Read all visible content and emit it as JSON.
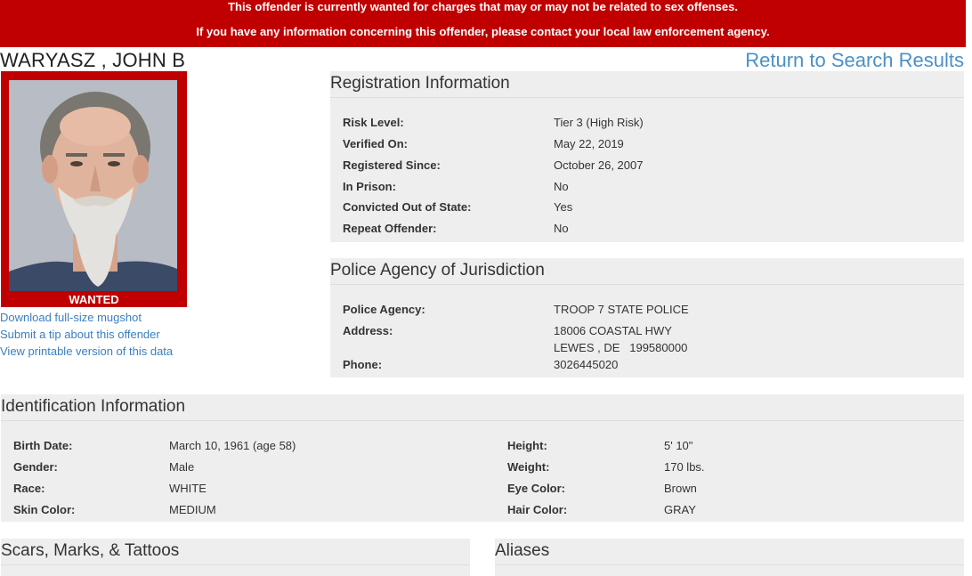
{
  "banner": {
    "line1": "This offender is currently wanted for charges that may or may not be related to sex offenses.",
    "line2": "If you have any information concerning this offender, please contact your local law enforcement agency."
  },
  "offender": {
    "name": "WARYASZ , JOHN B",
    "photo_label": "WANTED"
  },
  "links": {
    "return": "Return to Search Results",
    "download": "Download full-size mugshot",
    "tip": "Submit a tip about this offender",
    "printable": "View printable version of this data"
  },
  "registration": {
    "title": "Registration Information",
    "rows": [
      {
        "label": "Risk Level:",
        "value": "Tier 3 (High Risk)"
      },
      {
        "label": "Verified On:",
        "value": "May 22, 2019"
      },
      {
        "label": "Registered Since:",
        "value": "October 26, 2007"
      },
      {
        "label": "In Prison:",
        "value": "No"
      },
      {
        "label": "Convicted Out of State:",
        "value": "Yes"
      },
      {
        "label": "Repeat Offender:",
        "value": "No"
      }
    ]
  },
  "police": {
    "title": "Police Agency of Jurisdiction",
    "agency_label": "Police Agency:",
    "agency_value": "TROOP 7 STATE POLICE",
    "address_label": "Address:",
    "address_line1": "18006 COASTAL HWY",
    "address_line2": "LEWES , DE   199580000",
    "phone_label": "Phone:",
    "phone_value": "3026445020"
  },
  "identification": {
    "title": "Identification Information",
    "left": [
      {
        "label": "Birth Date:",
        "value": "March 10, 1961 (age 58)"
      },
      {
        "label": "Gender:",
        "value": "Male"
      },
      {
        "label": "Race:",
        "value": "WHITE"
      },
      {
        "label": "Skin Color:",
        "value": "MEDIUM"
      }
    ],
    "right": [
      {
        "label": "Height:",
        "value": "5' 10\""
      },
      {
        "label": "Weight:",
        "value": "170 lbs."
      },
      {
        "label": "Eye Color:",
        "value": "Brown"
      },
      {
        "label": "Hair Color:",
        "value": "GRAY"
      }
    ]
  },
  "scars": {
    "title": "Scars, Marks, & Tattoos"
  },
  "aliases": {
    "title": "Aliases"
  },
  "colors": {
    "banner": "#c00000",
    "link": "#3a7fbf",
    "panel": "#eeeeee"
  }
}
